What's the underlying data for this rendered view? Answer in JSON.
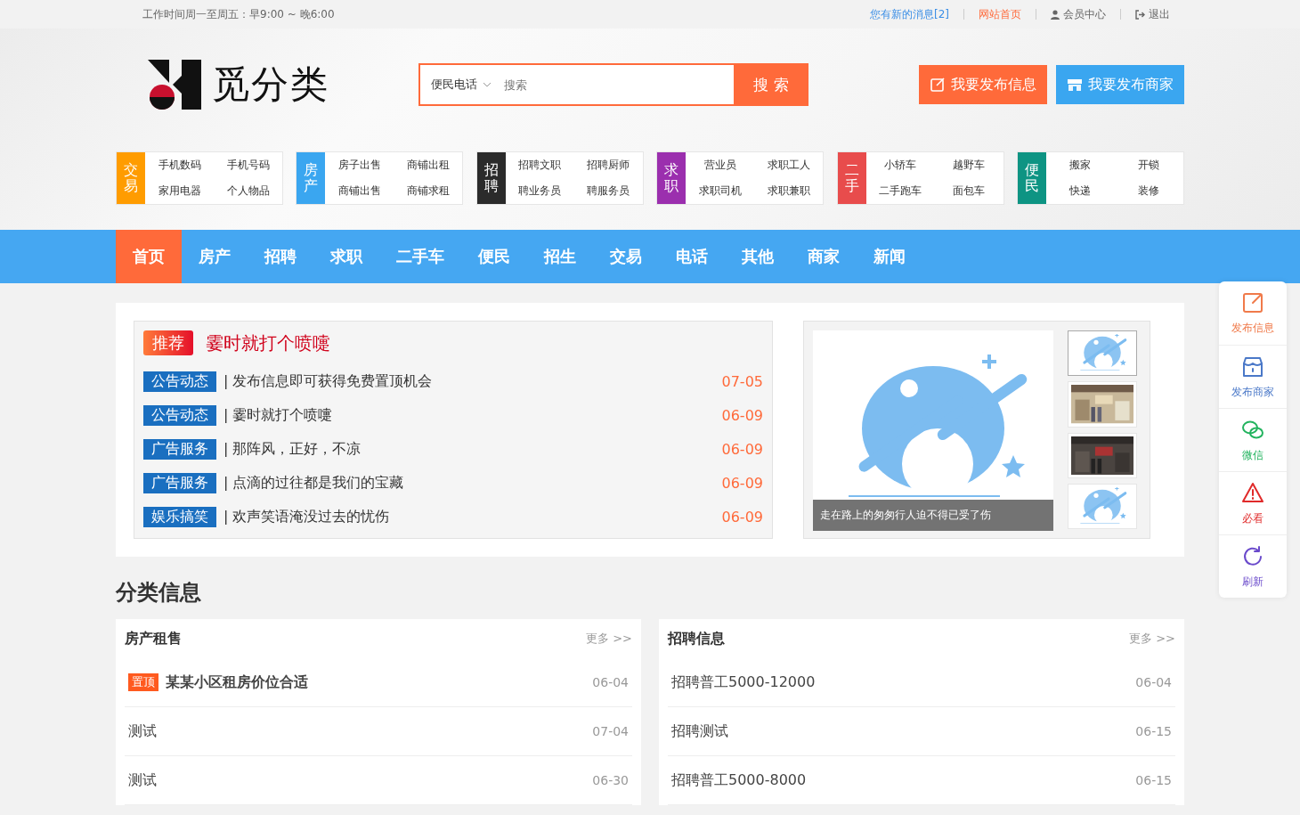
{
  "top_bar": {
    "hours": "工作时间周一至周五：早9:00 ~ 晚6:00",
    "links": [
      {
        "label": "您有新的消息[2]",
        "kind": "message"
      },
      {
        "label": "网站首页",
        "kind": "home"
      },
      {
        "label": "会员中心",
        "kind": "member"
      },
      {
        "label": "退出",
        "kind": "logout"
      }
    ]
  },
  "header": {
    "logo_text": "觅分类",
    "search": {
      "category": "便民电话",
      "placeholder": "搜索",
      "button": "搜 索"
    },
    "actions": [
      {
        "label": "我要发布信息",
        "kind": "info"
      },
      {
        "label": "我要发布商家",
        "kind": "merchant"
      }
    ]
  },
  "categories": [
    {
      "label": "交易",
      "color": "#ff9c00",
      "links": [
        "手机数码",
        "手机号码",
        "家用电器",
        "个人物品"
      ]
    },
    {
      "label": "房产",
      "color": "#3aa6f0",
      "links": [
        "房子出售",
        "商铺出租",
        "商铺出售",
        "商铺求租"
      ]
    },
    {
      "label": "招聘",
      "color": "#2b2b2b",
      "links": [
        "招聘文职",
        "招聘厨师",
        "聘业务员",
        "聘服务员"
      ]
    },
    {
      "label": "求职",
      "color": "#9b2fae",
      "links": [
        "营业员",
        "求职工人",
        "求职司机",
        "求职兼职"
      ]
    },
    {
      "label": "二手",
      "color": "#e84c4c",
      "links": [
        "小轿车",
        "越野车",
        "二手跑车",
        "面包车"
      ]
    },
    {
      "label": "便民",
      "color": "#0e9483",
      "links": [
        "搬家",
        "开锁",
        "快递",
        "装修"
      ]
    }
  ],
  "nav": [
    {
      "label": "首页",
      "selected": true
    },
    {
      "label": "房产",
      "selected": false
    },
    {
      "label": "招聘",
      "selected": false
    },
    {
      "label": "求职",
      "selected": false
    },
    {
      "label": "二手车",
      "selected": false
    },
    {
      "label": "便民",
      "selected": false
    },
    {
      "label": "招生",
      "selected": false
    },
    {
      "label": "交易",
      "selected": false
    },
    {
      "label": "电话",
      "selected": false
    },
    {
      "label": "其他",
      "selected": false
    },
    {
      "label": "商家",
      "selected": false
    },
    {
      "label": "新闻",
      "selected": false
    }
  ],
  "featured": {
    "badge": "推荐",
    "headline": "霎时就打个喷嚏",
    "items": [
      {
        "tag": "公告动态",
        "title": "| 发布信息即可获得免费置顶机会",
        "date": "07-05"
      },
      {
        "tag": "公告动态",
        "title": "| 霎时就打个喷嚏",
        "date": "06-09"
      },
      {
        "tag": "广告服务",
        "title": "| 那阵风，正好，不凉",
        "date": "06-09"
      },
      {
        "tag": "广告服务",
        "title": "| 点滴的过往都是我们的宝藏",
        "date": "06-09"
      },
      {
        "tag": "娱乐搞笑",
        "title": "| 欢声笑语淹没过去的忧伤",
        "date": "06-09"
      }
    ]
  },
  "slideshow": {
    "caption": "走在路上的匆匆行人迫不得已受了伤",
    "thumbnails": [
      {
        "kind": "placeholder",
        "selected": true
      },
      {
        "kind": "shop",
        "selected": false
      },
      {
        "kind": "interior",
        "selected": false
      },
      {
        "kind": "placeholder",
        "selected": false
      }
    ]
  },
  "side_dock": [
    {
      "label": "发布信息",
      "kind": "edit"
    },
    {
      "label": "发布商家",
      "kind": "shop"
    },
    {
      "label": "微信",
      "kind": "wechat"
    },
    {
      "label": "必看",
      "kind": "alert"
    },
    {
      "label": "刷新",
      "kind": "refresh"
    }
  ],
  "section_title": "分类信息",
  "lists": [
    {
      "title": "房产租售",
      "more": "更多 >>",
      "rows": [
        {
          "title": "某某小区租房价位合适",
          "date": "06-04",
          "pinned": true,
          "badge": "置顶"
        },
        {
          "title": "测试",
          "date": "07-04",
          "pinned": false
        },
        {
          "title": "测试",
          "date": "06-30",
          "pinned": false
        }
      ]
    },
    {
      "title": "招聘信息",
      "more": "更多 >>",
      "rows": [
        {
          "title": "招聘普工5000-12000",
          "date": "06-04",
          "pinned": false
        },
        {
          "title": "招聘测试",
          "date": "06-15",
          "pinned": false
        },
        {
          "title": "招聘普工5000-8000",
          "date": "06-15",
          "pinned": false
        }
      ]
    }
  ]
}
